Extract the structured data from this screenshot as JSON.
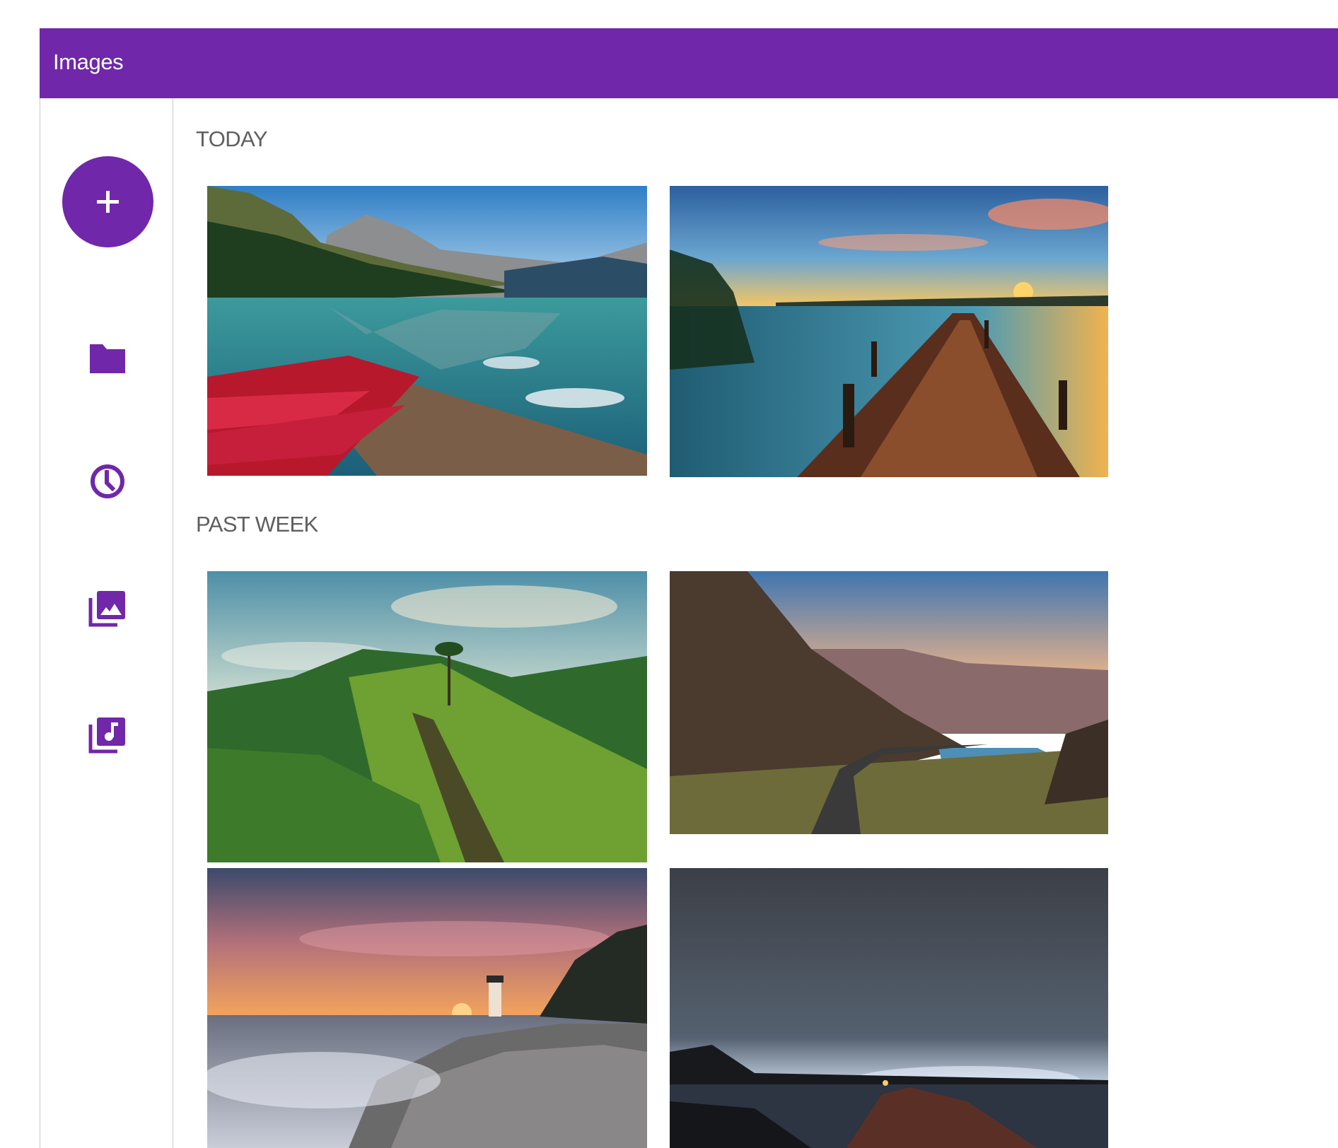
{
  "appbar": {
    "title": "Images",
    "color": "#7027a9"
  },
  "sidebar": {
    "fab": {
      "icon": "plus-icon"
    },
    "items": [
      {
        "icon": "folder-icon"
      },
      {
        "icon": "clock-icon"
      },
      {
        "icon": "photo-library-icon"
      },
      {
        "icon": "music-library-icon"
      }
    ]
  },
  "sections": [
    {
      "heading": "TODAY"
    },
    {
      "heading": "PAST WEEK"
    }
  ],
  "photos": [
    {
      "subject": "mountain-lake-with-red-canoes",
      "section": "TODAY"
    },
    {
      "subject": "wooden-pier-at-sunset",
      "section": "TODAY"
    },
    {
      "subject": "green-hill-with-path-and-palm",
      "section": "PAST WEEK"
    },
    {
      "subject": "mountain-road-by-fjord",
      "section": "PAST WEEK"
    },
    {
      "subject": "lighthouse-with-rocks-at-sunset",
      "section": "PAST WEEK"
    },
    {
      "subject": "night-sky-over-lake",
      "section": "PAST WEEK"
    }
  ]
}
